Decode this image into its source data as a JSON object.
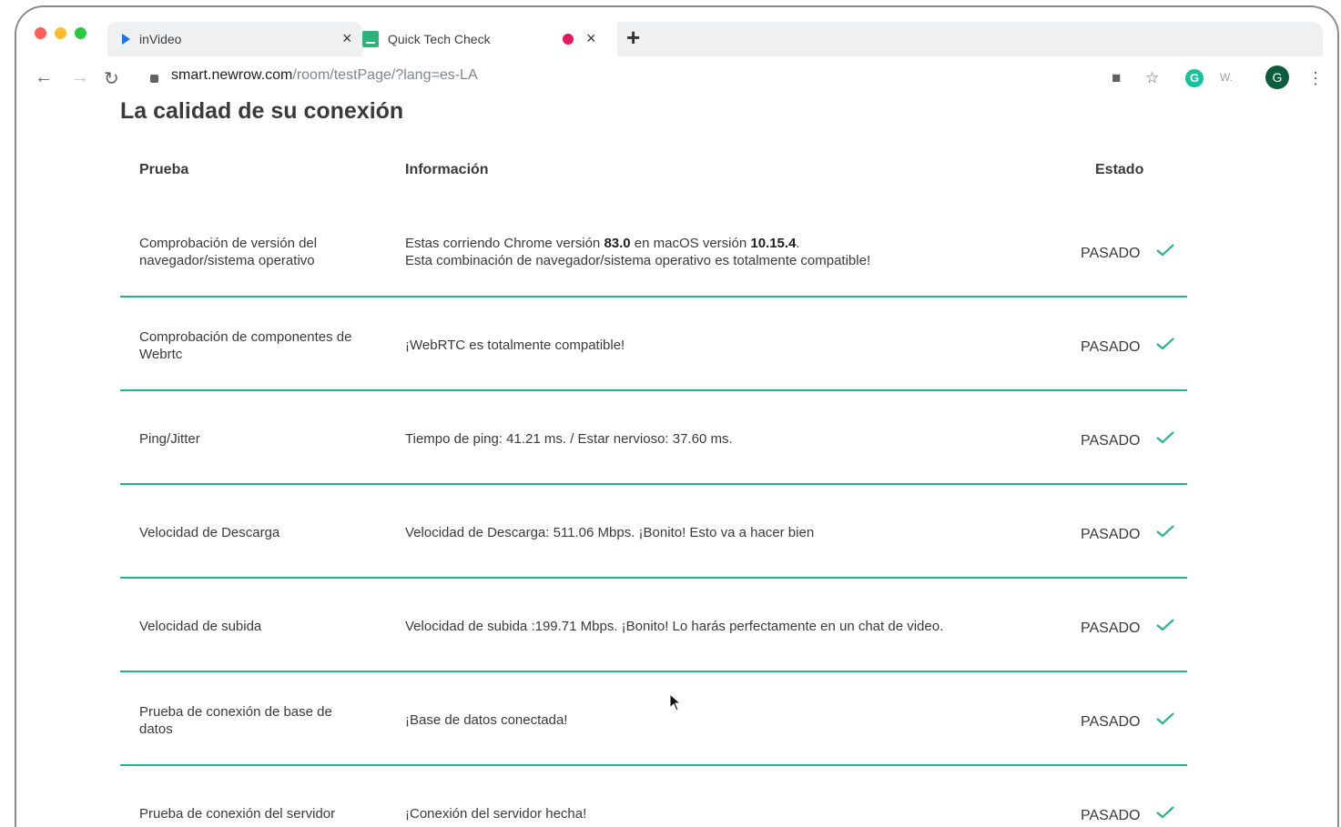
{
  "browser": {
    "tabs": [
      {
        "label": "inVideo"
      },
      {
        "label": "Quick Tech Check"
      }
    ],
    "url_host": "smart.newrow.com",
    "url_path": "/room/testPage/?lang=es-LA",
    "profile_initial": "G",
    "extension_label": "W."
  },
  "page": {
    "title": "La calidad de su conexión",
    "columns": {
      "test": "Prueba",
      "info": "Información",
      "status": "Estado"
    },
    "rows": [
      {
        "test": "Comprobación de versión del navegador/sistema operativo",
        "info_line1_a": "Estas corriendo Chrome versión ",
        "info_line1_b": "83.0",
        "info_line1_c": " en macOS versión ",
        "info_line1_d": "10.15.4",
        "info_line1_e": ".",
        "info_line2": "Esta combinación de navegador/sistema operativo es totalmente compatible!",
        "status": "PASADO"
      },
      {
        "test": "Comprobación de componentes de Webrtc",
        "info": "¡WebRTC es totalmente compatible!",
        "status": "PASADO"
      },
      {
        "test": "Ping/Jitter",
        "info": "Tiempo de ping: 41.21 ms. / Estar nervioso: 37.60 ms.",
        "status": "PASADO"
      },
      {
        "test": "Velocidad de Descarga",
        "info": "Velocidad de Descarga: 511.06 Mbps. ¡Bonito! Esto va a hacer bien",
        "status": "PASADO"
      },
      {
        "test": "Velocidad de subida",
        "info": "Velocidad de subida :199.71 Mbps. ¡Bonito! Lo harás perfectamente en un chat de video.",
        "status": "PASADO"
      },
      {
        "test": "Prueba de conexión de base de datos",
        "info": "¡Base de datos conectada!",
        "status": "PASADO"
      },
      {
        "test": "Prueba de conexión del servidor",
        "info": "¡Conexión del servidor hecha!",
        "status": "PASADO"
      }
    ]
  },
  "colors": {
    "accent": "#26b38c",
    "check": "#26b38c"
  }
}
